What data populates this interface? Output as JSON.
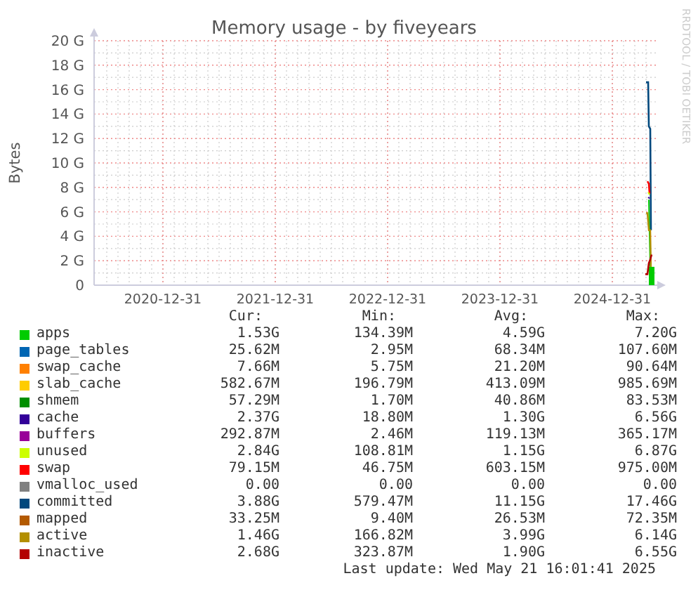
{
  "chart": {
    "title": "Memory usage - by fiveyears",
    "ylabel": "Bytes",
    "side_text": "RRDTOOL / TOBI OETIKER",
    "yticks": [
      "20 G",
      "18 G",
      "16 G",
      "14 G",
      "12 G",
      "10 G",
      "8 G",
      "6 G",
      "4 G",
      "2 G",
      "0"
    ],
    "xticks": [
      "2020-12-31",
      "2021-12-31",
      "2022-12-31",
      "2023-12-31",
      "2024-12-31"
    ]
  },
  "legend": {
    "headers": [
      "Cur:",
      "Min:",
      "Avg:",
      "Max:"
    ],
    "rows": [
      {
        "name": "apps",
        "color": "#00cc00",
        "cur": "1.53G",
        "min": "134.39M",
        "avg": "4.59G",
        "max": "7.20G"
      },
      {
        "name": "page_tables",
        "color": "#0066b3",
        "cur": "25.62M",
        "min": "2.95M",
        "avg": "68.34M",
        "max": "107.60M"
      },
      {
        "name": "swap_cache",
        "color": "#ff8000",
        "cur": "7.66M",
        "min": "5.75M",
        "avg": "21.20M",
        "max": "90.64M"
      },
      {
        "name": "slab_cache",
        "color": "#ffcc00",
        "cur": "582.67M",
        "min": "196.79M",
        "avg": "413.09M",
        "max": "985.69M"
      },
      {
        "name": "shmem",
        "color": "#008f00",
        "cur": "57.29M",
        "min": "1.70M",
        "avg": "40.86M",
        "max": "83.53M"
      },
      {
        "name": "cache",
        "color": "#330099",
        "cur": "2.37G",
        "min": "18.80M",
        "avg": "1.30G",
        "max": "6.56G"
      },
      {
        "name": "buffers",
        "color": "#990099",
        "cur": "292.87M",
        "min": "2.46M",
        "avg": "119.13M",
        "max": "365.17M"
      },
      {
        "name": "unused",
        "color": "#ccff00",
        "cur": "2.84G",
        "min": "108.81M",
        "avg": "1.15G",
        "max": "6.87G"
      },
      {
        "name": "swap",
        "color": "#ff0000",
        "cur": "79.15M",
        "min": "46.75M",
        "avg": "603.15M",
        "max": "975.00M"
      },
      {
        "name": "vmalloc_used",
        "color": "#808080",
        "cur": "0.00",
        "min": "0.00",
        "avg": "0.00",
        "max": "0.00"
      },
      {
        "name": "committed",
        "color": "#00487d",
        "cur": "3.88G",
        "min": "579.47M",
        "avg": "11.15G",
        "max": "17.46G"
      },
      {
        "name": "mapped",
        "color": "#b35a00",
        "cur": "33.25M",
        "min": "9.40M",
        "avg": "26.53M",
        "max": "72.35M"
      },
      {
        "name": "active",
        "color": "#b38f00",
        "cur": "1.46G",
        "min": "166.82M",
        "avg": "3.99G",
        "max": "6.14G"
      },
      {
        "name": "inactive",
        "color": "#b30000",
        "cur": "2.68G",
        "min": "323.87M",
        "avg": "1.90G",
        "max": "6.55G"
      }
    ]
  },
  "last_update": "Last update: Wed May 21 16:01:41 2025"
}
